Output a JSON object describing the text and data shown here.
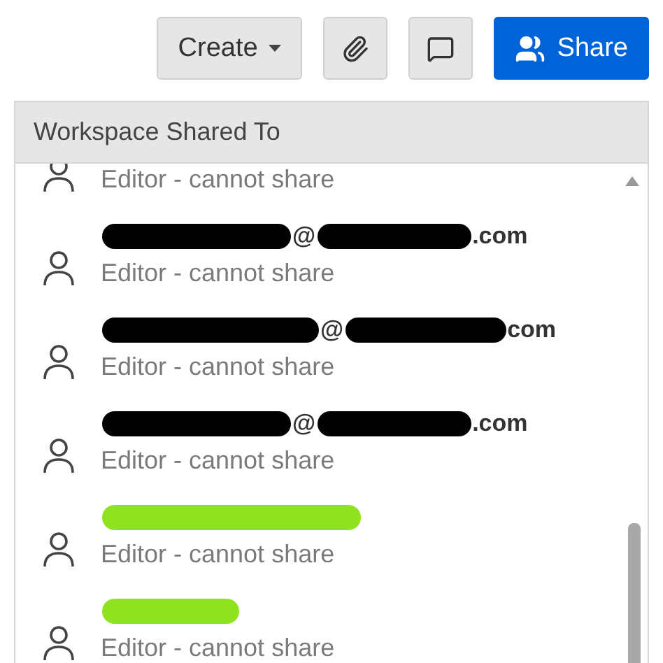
{
  "toolbar": {
    "buttons": [
      {
        "kind": "create",
        "label": "Create"
      },
      {
        "kind": "attach"
      },
      {
        "kind": "comment"
      },
      {
        "kind": "share",
        "label": "Share"
      }
    ]
  },
  "panel": {
    "title": "Workspace Shared To",
    "members": [
      {
        "role": "Editor - cannot share"
      },
      {
        "name_pieces": [
          {
            "kind": "redaction",
            "color": "#000000"
          },
          {
            "kind": "text",
            "text": "@"
          },
          {
            "kind": "redaction",
            "color": "#000000"
          },
          {
            "kind": "text",
            "text": ".com"
          }
        ],
        "role": "Editor - cannot share"
      },
      {
        "name_pieces": [
          {
            "kind": "redaction",
            "color": "#000000"
          },
          {
            "kind": "text",
            "text": "@"
          },
          {
            "kind": "redaction",
            "color": "#000000"
          },
          {
            "kind": "text",
            "text": "com"
          }
        ],
        "role": "Editor - cannot share"
      },
      {
        "name_pieces": [
          {
            "kind": "redaction",
            "color": "#000000"
          },
          {
            "kind": "text",
            "text": "@"
          },
          {
            "kind": "redaction",
            "color": "#000000"
          },
          {
            "kind": "text",
            "text": ".com"
          }
        ],
        "role": "Editor - cannot share"
      },
      {
        "name_pieces": [
          {
            "kind": "redaction",
            "color": "#8fe21e"
          }
        ],
        "role": "Editor - cannot share"
      },
      {
        "name_pieces": [
          {
            "kind": "redaction",
            "color": "#8fe21e"
          }
        ],
        "role": "Editor - cannot share"
      }
    ]
  }
}
